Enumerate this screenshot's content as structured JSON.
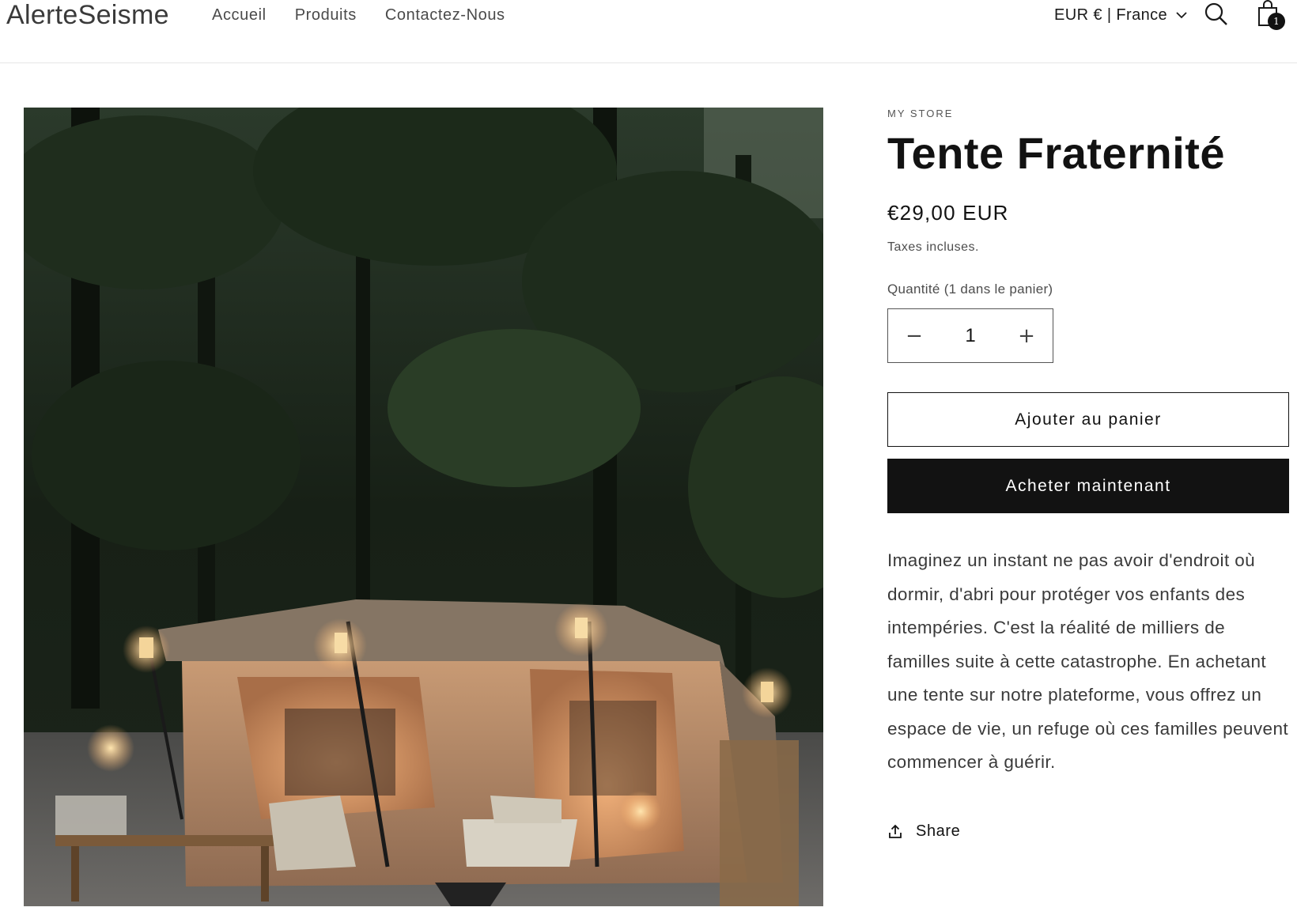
{
  "header": {
    "logo": "AlerteSeisme",
    "nav": [
      "Accueil",
      "Produits",
      "Contactez-Nous"
    ],
    "locale": "EUR € | France",
    "cart_count": "1",
    "icons": {
      "search": "search-icon",
      "cart": "cart-icon",
      "chevron": "chevron-down-icon"
    }
  },
  "product": {
    "vendor": "MY STORE",
    "title": "Tente Fraternité",
    "price": "€29,00 EUR",
    "tax_note": "Taxes incluses.",
    "quantity_label": "Quantité (1 dans le panier)",
    "quantity_value": "1",
    "decrease_label": "−",
    "increase_label": "+",
    "add_to_cart": "Ajouter au panier",
    "buy_now": "Acheter maintenant",
    "description": "Imaginez un instant ne pas avoir d'endroit où dormir, d'abri pour protéger vos enfants des intempéries. C'est la réalité de milliers de familles suite à cette catastrophe. En achetant une tente sur notre plateforme, vous offrez un espace de vie, un refuge où ces familles peuvent commencer à guérir.",
    "share_label": "Share",
    "image_icon": "tent-photo"
  },
  "colors": {
    "text": "#121212",
    "muted": "#4d4d4d",
    "button_dark": "#121212",
    "border": "#e6e6e6"
  }
}
